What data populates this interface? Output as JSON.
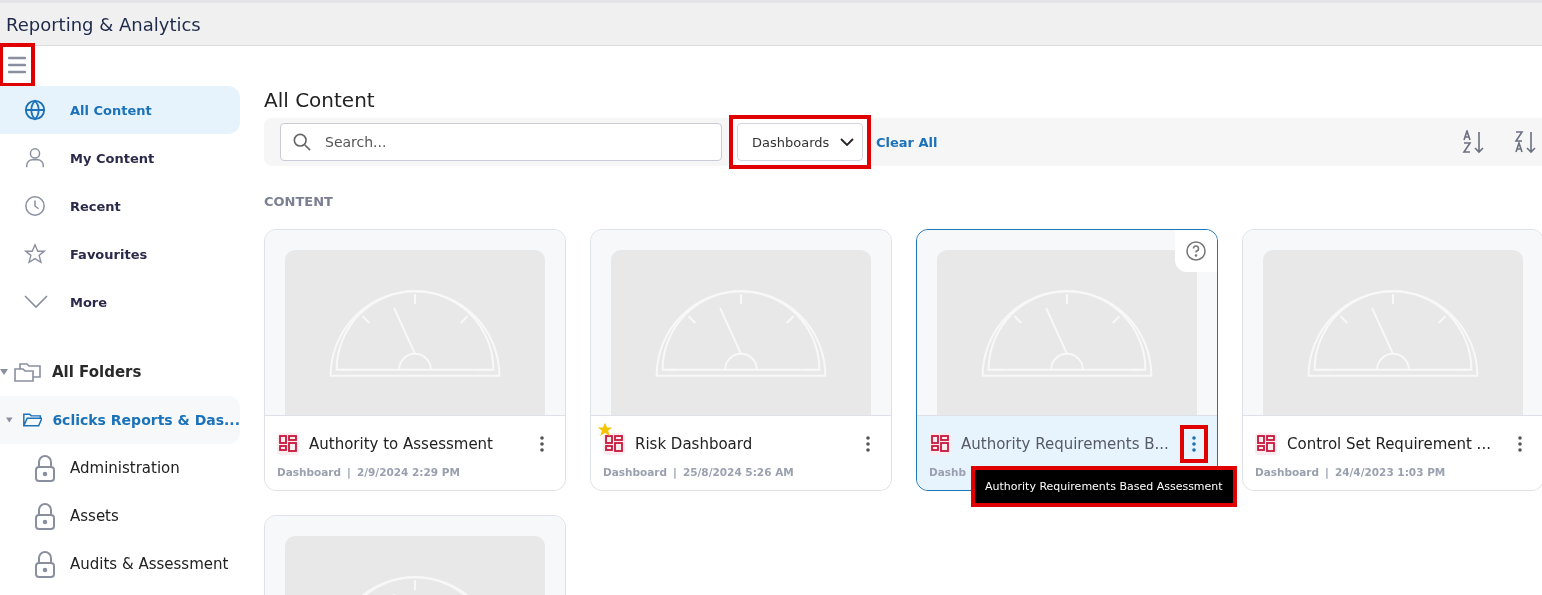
{
  "window": {
    "title": "Reporting & Analytics"
  },
  "menu_button": {
    "highlighted": true
  },
  "nav": [
    {
      "label": "All Content",
      "selected": true
    },
    {
      "label": "My Content",
      "selected": false
    },
    {
      "label": "Recent",
      "selected": false
    },
    {
      "label": "Favourites",
      "selected": false
    },
    {
      "label": "More",
      "selected": false
    }
  ],
  "folders": {
    "label": "All Folders",
    "expanded": true,
    "children": [
      {
        "label": "6clicks Reports & Das...",
        "expanded": true,
        "selected": true,
        "children": [
          {
            "label": "Administration"
          },
          {
            "label": "Assets"
          },
          {
            "label": "Audits & Assessment"
          }
        ]
      }
    ]
  },
  "page_title": "All Content",
  "search": {
    "placeholder": "Search..."
  },
  "type_filter": {
    "value": "Dashboards",
    "highlighted": true
  },
  "clear_all": "Clear All",
  "section_label": "CONTENT",
  "cards": [
    {
      "kind": "full",
      "title": "Authority to Assessment",
      "type": "Dashboard",
      "separator": "|",
      "date": "2/9/2024 2:29 PM",
      "favourite": false,
      "selected": false,
      "menu_highlighted": false
    },
    {
      "kind": "full",
      "title": "Risk Dashboard",
      "type": "Dashboard",
      "separator": "|",
      "date": "25/8/2024 5:26 AM",
      "favourite": true,
      "selected": false,
      "menu_highlighted": false
    },
    {
      "kind": "full",
      "title": "Authority Requirements B...",
      "type": "Dashb",
      "favourite": false,
      "selected": true,
      "menu_highlighted": true,
      "tooltip": "Authority Requirements Based Assessment"
    },
    {
      "kind": "full",
      "title": "Control Set Requirement ...",
      "type": "Dashboard",
      "separator": "|",
      "date": "24/4/2023 1:03 PM",
      "favourite": false,
      "selected": false,
      "menu_highlighted": false
    },
    {
      "kind": "thumbnail"
    }
  ]
}
